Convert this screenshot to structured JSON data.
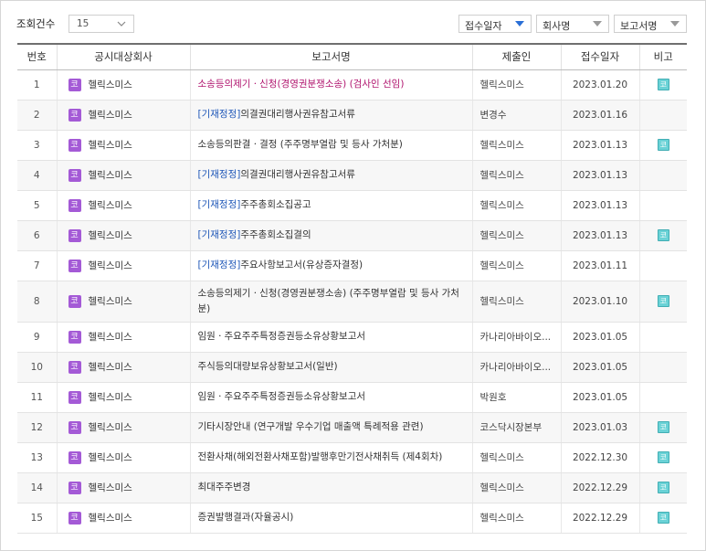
{
  "filter": {
    "count_label": "조회건수",
    "count_value": "15",
    "sort": [
      "접수일자",
      "회사명",
      "보고서명"
    ]
  },
  "colors": {
    "company_badge": "#a45ad6",
    "note_icon": "#6ad2d6",
    "tag_blue": "#1f57b8",
    "link_pink": "#b0146e"
  },
  "table": {
    "headers": [
      "번호",
      "공시대상회사",
      "보고서명",
      "제출인",
      "접수일자",
      "비고"
    ],
    "rows": [
      {
        "no": "1",
        "badge": "코",
        "company": "헬릭스미스",
        "tag": "",
        "report": "소송등의제기ㆍ신청(경영권분쟁소송) (검사인 선임)",
        "submitter": "헬릭스미스",
        "date": "2023.01.20",
        "note": "코",
        "pink": true
      },
      {
        "no": "2",
        "badge": "코",
        "company": "헬릭스미스",
        "tag": "[기재정정]",
        "report": "의결권대리행사권유참고서류",
        "submitter": "변경수",
        "date": "2023.01.16",
        "note": ""
      },
      {
        "no": "3",
        "badge": "코",
        "company": "헬릭스미스",
        "tag": "",
        "report": "소송등의판결ㆍ결정 (주주명부열람 및 등사 가처분)",
        "submitter": "헬릭스미스",
        "date": "2023.01.13",
        "note": "코"
      },
      {
        "no": "4",
        "badge": "코",
        "company": "헬릭스미스",
        "tag": "[기재정정]",
        "report": "의결권대리행사권유참고서류",
        "submitter": "헬릭스미스",
        "date": "2023.01.13",
        "note": ""
      },
      {
        "no": "5",
        "badge": "코",
        "company": "헬릭스미스",
        "tag": "[기재정정]",
        "report": "주주총회소집공고",
        "submitter": "헬릭스미스",
        "date": "2023.01.13",
        "note": ""
      },
      {
        "no": "6",
        "badge": "코",
        "company": "헬릭스미스",
        "tag": "[기재정정]",
        "report": "주주총회소집결의",
        "submitter": "헬릭스미스",
        "date": "2023.01.13",
        "note": "코"
      },
      {
        "no": "7",
        "badge": "코",
        "company": "헬릭스미스",
        "tag": "[기재정정]",
        "report": "주요사항보고서(유상증자결정)",
        "submitter": "헬릭스미스",
        "date": "2023.01.11",
        "note": ""
      },
      {
        "no": "8",
        "badge": "코",
        "company": "헬릭스미스",
        "tag": "",
        "report": "소송등의제기ㆍ신청(경영권분쟁소송) (주주명부열람 및 등사 가처분)",
        "submitter": "헬릭스미스",
        "date": "2023.01.10",
        "note": "코",
        "tall": true
      },
      {
        "no": "9",
        "badge": "코",
        "company": "헬릭스미스",
        "tag": "",
        "report": "임원ㆍ주요주주특정증권등소유상황보고서",
        "submitter": "카나리아바이오...",
        "date": "2023.01.05",
        "note": ""
      },
      {
        "no": "10",
        "badge": "코",
        "company": "헬릭스미스",
        "tag": "",
        "report": "주식등의대량보유상황보고서(일반)",
        "submitter": "카나리아바이오...",
        "date": "2023.01.05",
        "note": ""
      },
      {
        "no": "11",
        "badge": "코",
        "company": "헬릭스미스",
        "tag": "",
        "report": "임원ㆍ주요주주특정증권등소유상황보고서",
        "submitter": "박원호",
        "date": "2023.01.05",
        "note": ""
      },
      {
        "no": "12",
        "badge": "코",
        "company": "헬릭스미스",
        "tag": "",
        "report": "기타시장안내 (연구개발 우수기업 매출액 특례적용 관련)",
        "submitter": "코스닥시장본부",
        "date": "2023.01.03",
        "note": "코"
      },
      {
        "no": "13",
        "badge": "코",
        "company": "헬릭스미스",
        "tag": "",
        "report": "전환사채(해외전환사채포함)발행후만기전사채취득 (제4회차)",
        "submitter": "헬릭스미스",
        "date": "2022.12.30",
        "note": "코"
      },
      {
        "no": "14",
        "badge": "코",
        "company": "헬릭스미스",
        "tag": "",
        "report": "최대주주변경",
        "submitter": "헬릭스미스",
        "date": "2022.12.29",
        "note": "코"
      },
      {
        "no": "15",
        "badge": "코",
        "company": "헬릭스미스",
        "tag": "",
        "report": "증권발행결과(자율공시)",
        "submitter": "헬릭스미스",
        "date": "2022.12.29",
        "note": "코"
      }
    ]
  }
}
